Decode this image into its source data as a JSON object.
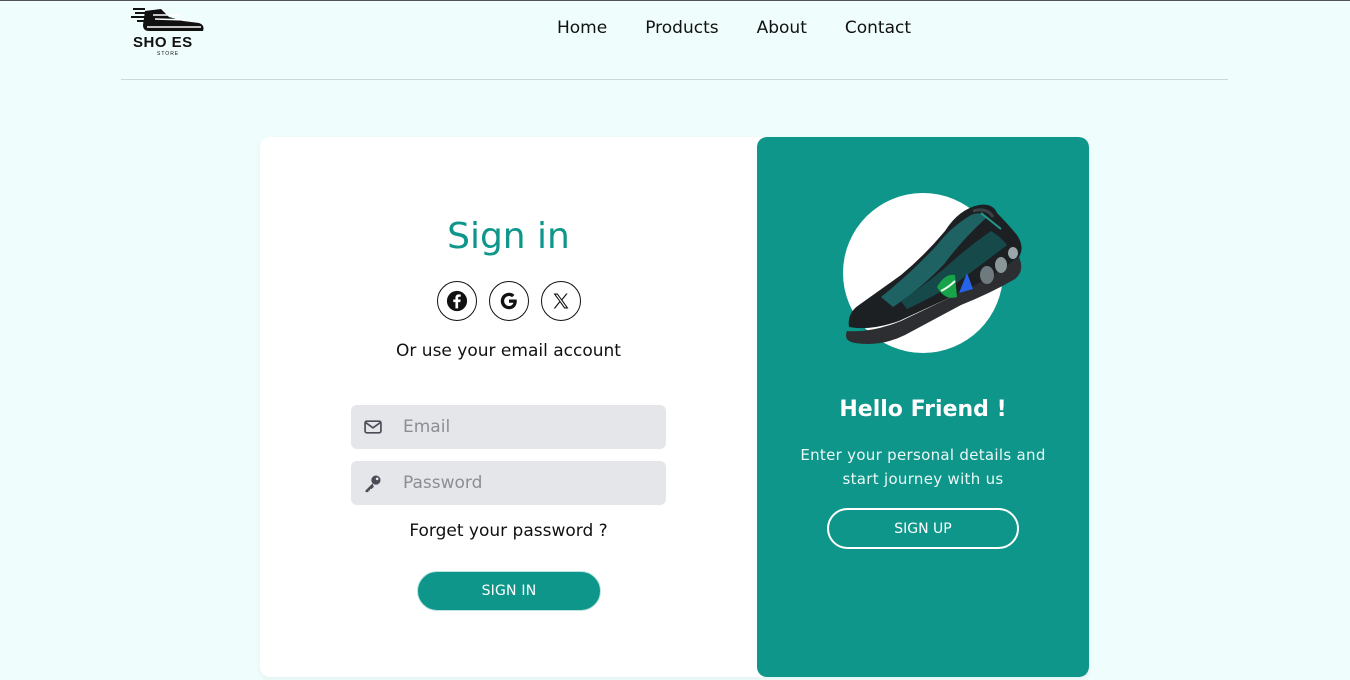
{
  "brand": {
    "logo_text": "SHO ES",
    "logo_sub": "STORE"
  },
  "nav": {
    "items": [
      "Home",
      "Products",
      "About",
      "Contact"
    ]
  },
  "signin": {
    "title": "Sign in",
    "social": [
      "facebook-icon",
      "google-icon",
      "x-icon"
    ],
    "alt_text": "Or use your email account",
    "email_placeholder": "Email",
    "password_placeholder": "Password",
    "forgot": "Forget your password ?",
    "button": "SIGN IN"
  },
  "promo": {
    "title": "Hello Friend !",
    "description": "Enter your personal details and start journey with us",
    "button": "SIGN UP"
  },
  "colors": {
    "accent": "#0e968a",
    "background": "#effdfc",
    "field": "#e5e6ea"
  }
}
